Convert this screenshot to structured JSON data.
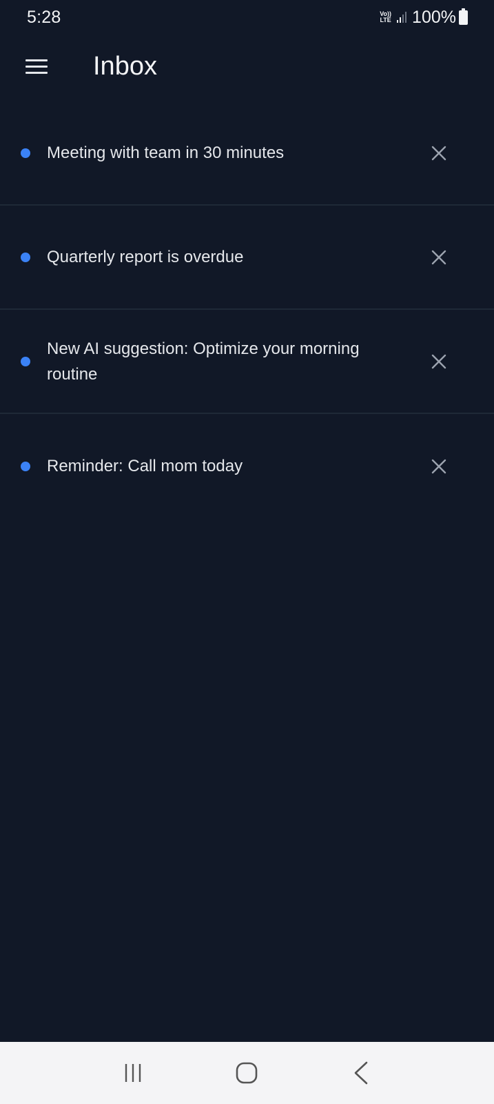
{
  "status_bar": {
    "time": "5:28",
    "network_top": "Vo))",
    "network_bottom": "LTE",
    "battery_percent": "100%",
    "signal_icon": "signal-bars-icon",
    "battery_icon": "battery-icon"
  },
  "app_bar": {
    "title": "Inbox",
    "menu_icon": "hamburger-menu-icon"
  },
  "notifications": [
    {
      "text": "Meeting with team in 30 minutes",
      "unread": true
    },
    {
      "text": "Quarterly report is overdue",
      "unread": true
    },
    {
      "text": "New AI suggestion: Optimize your morning routine",
      "unread": true
    },
    {
      "text": "Reminder: Call mom today",
      "unread": true
    }
  ],
  "nav_bar": {
    "recents_icon": "recent-apps-icon",
    "home_icon": "home-icon",
    "back_icon": "back-icon"
  },
  "colors": {
    "background": "#111827",
    "accent_dot": "#3b82f6",
    "divider": "#1f2937",
    "nav_bar": "#f4f4f6"
  }
}
